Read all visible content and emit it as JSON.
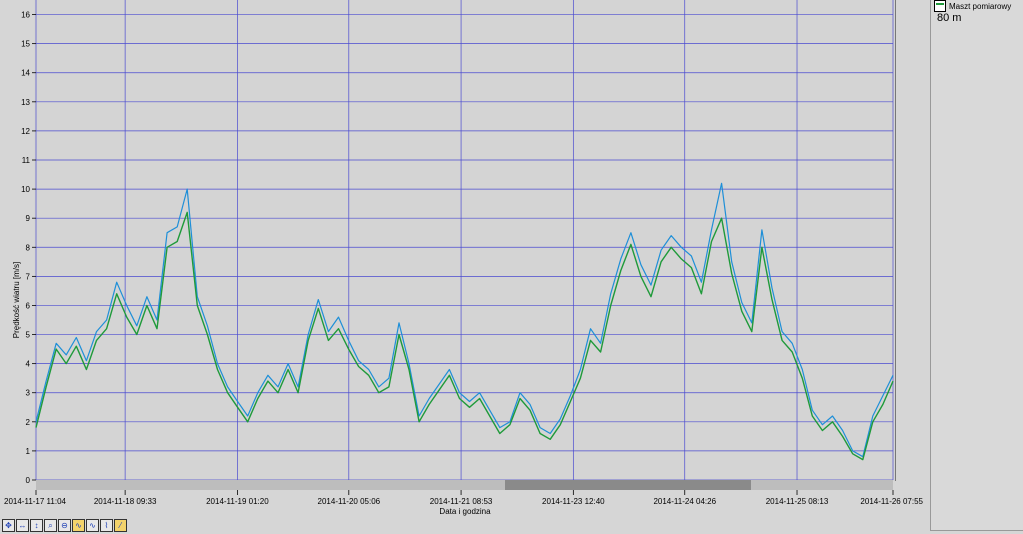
{
  "chart_data": {
    "type": "line",
    "ylabel": "Prędkość wiatru [m/s]",
    "xlabel": "Data i godzina",
    "ylim": [
      0,
      16.5
    ],
    "yticks": [
      0,
      1,
      2,
      3,
      4,
      5,
      6,
      7,
      8,
      9,
      10,
      11,
      12,
      13,
      14,
      15,
      16
    ],
    "x_tick_labels": [
      "2014-11-17 11:04",
      "2014-11-18 09:33",
      "2014-11-19 01:20",
      "2014-11-20 05:06",
      "2014-11-21 08:53",
      "2014-11-23 12:40",
      "2014-11-24 04:26",
      "2014-11-25 08:13",
      "2014-11-26 07:55"
    ],
    "x_tick_positions": [
      0,
      0.104,
      0.235,
      0.365,
      0.496,
      0.627,
      0.757,
      0.888,
      1.0
    ],
    "grid": true,
    "series": [
      {
        "name": "Maszt pomiarowy",
        "color": "#1f9a3a",
        "values": [
          1.8,
          3.2,
          4.5,
          4.0,
          4.6,
          3.8,
          4.8,
          5.2,
          6.4,
          5.6,
          5.0,
          6.0,
          5.2,
          8.0,
          8.2,
          9.2,
          6.0,
          5.0,
          3.8,
          3.0,
          2.5,
          2.0,
          2.8,
          3.4,
          3.0,
          3.8,
          3.0,
          4.8,
          5.9,
          4.8,
          5.2,
          4.5,
          3.9,
          3.6,
          3.0,
          3.2,
          5.0,
          3.8,
          2.0,
          2.6,
          3.1,
          3.6,
          2.8,
          2.5,
          2.8,
          2.2,
          1.6,
          1.9,
          2.8,
          2.4,
          1.6,
          1.4,
          1.9,
          2.7,
          3.5,
          4.8,
          4.4,
          6.0,
          7.2,
          8.1,
          7.0,
          6.3,
          7.5,
          8.0,
          7.6,
          7.3,
          6.4,
          8.2,
          9.0,
          7.1,
          5.8,
          5.1,
          8.0,
          6.2,
          4.8,
          4.4,
          3.5,
          2.2,
          1.7,
          2.0,
          1.5,
          0.9,
          0.7,
          2.0,
          2.6,
          3.4
        ]
      },
      {
        "name": "",
        "color": "#1e8fd8",
        "values": [
          2.0,
          3.4,
          4.7,
          4.3,
          4.9,
          4.1,
          5.1,
          5.5,
          6.8,
          6.0,
          5.3,
          6.3,
          5.5,
          8.5,
          8.7,
          10.0,
          6.3,
          5.3,
          4.0,
          3.2,
          2.7,
          2.2,
          3.0,
          3.6,
          3.2,
          4.0,
          3.2,
          5.0,
          6.2,
          5.1,
          5.6,
          4.8,
          4.1,
          3.8,
          3.2,
          3.5,
          5.4,
          4.0,
          2.2,
          2.8,
          3.3,
          3.8,
          3.0,
          2.7,
          3.0,
          2.4,
          1.8,
          2.0,
          3.0,
          2.6,
          1.8,
          1.6,
          2.1,
          2.9,
          3.8,
          5.2,
          4.7,
          6.4,
          7.6,
          8.5,
          7.4,
          6.7,
          7.9,
          8.4,
          8.0,
          7.7,
          6.8,
          8.6,
          10.2,
          7.5,
          6.1,
          5.4,
          8.6,
          6.6,
          5.1,
          4.7,
          3.8,
          2.4,
          1.9,
          2.2,
          1.7,
          1.0,
          0.8,
          2.2,
          2.9,
          3.6
        ]
      }
    ]
  },
  "legend": {
    "label": "Maszt pomiarowy",
    "height": "80 m"
  },
  "toolbar": {
    "icons": [
      "pan-icon",
      "zoom-x-icon",
      "zoom-y-icon",
      "zoom-icon",
      "zoom-out-icon",
      "series-icon",
      "series-alt-icon",
      "trend-icon",
      "line-icon"
    ]
  }
}
